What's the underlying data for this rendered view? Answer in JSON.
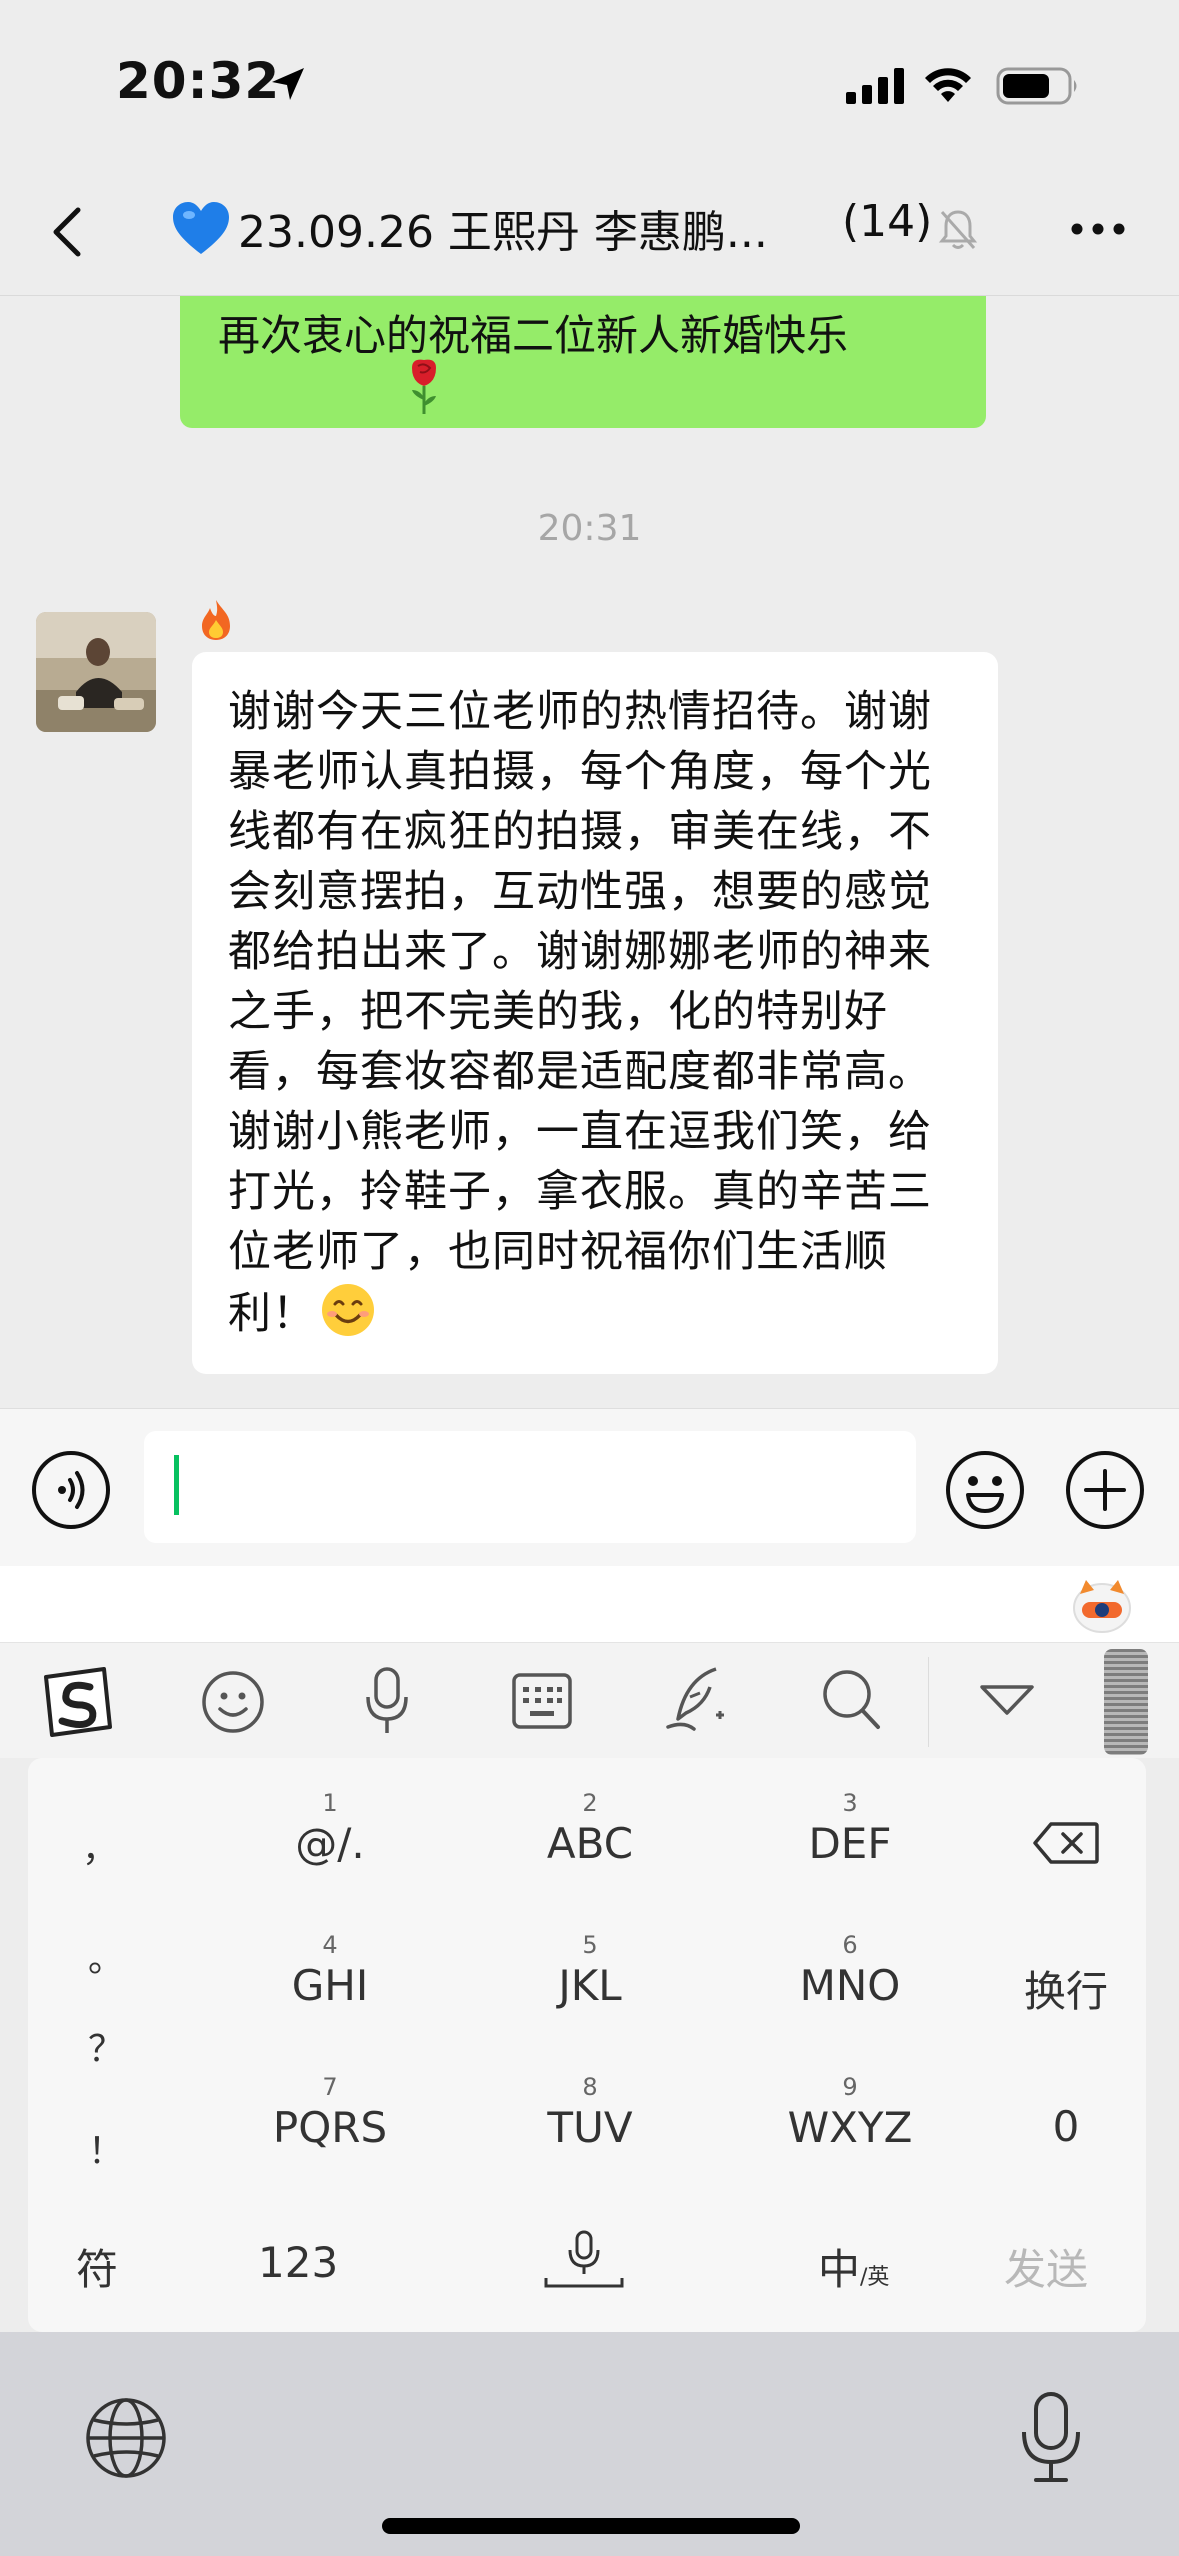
{
  "status_bar": {
    "time": "20:32",
    "icons": [
      "location-arrow-icon",
      "cellular-signal-icon",
      "wifi-icon",
      "battery-icon"
    ]
  },
  "nav": {
    "title": "23.09.26 王熙丹 李惠鹏...",
    "member_count": "(14)",
    "title_emoji": "blue-heart-icon",
    "icons": [
      "back-icon",
      "mute-bell-icon",
      "more-icon"
    ]
  },
  "messages": {
    "previous": {
      "text": "再次衷心的祝福二位新人新婚快乐",
      "emoji": "rose-icon",
      "bubble_color": "#95ec69"
    },
    "time_divider": "20:31",
    "incoming": {
      "sender_emoji": "fire-icon",
      "text": "谢谢今天三位老师的热情招待。谢谢暴老师认真拍摄，每个角度，每个光线都有在疯狂的拍摄，审美在线，不会刻意摆拍，互动性强，想要的感觉都给拍出来了。谢谢娜娜老师的神来之手，把不完美的我，化的特别好看，每套妆容都是适配度都非常高。谢谢小熊老师，一直在逗我们笑，给打光，拎鞋子，拿衣服。真的辛苦三位老师了，也同时祝福你们生活顺利！",
      "emoji": "smiling-face-icon"
    }
  },
  "input_bar": {
    "value": "",
    "cursor_color": "#07c160",
    "icons": [
      "voice-icon",
      "emoji-icon",
      "plus-icon"
    ]
  },
  "keyboard": {
    "toolbar_icons": [
      "sogou-logo-icon",
      "emoji-icon",
      "microphone-icon",
      "keyboard-icon",
      "handwriting-icon",
      "search-icon",
      "collapse-icon"
    ],
    "punctuation": [
      "，",
      "。",
      "？",
      "！"
    ],
    "keys": [
      {
        "num": "1",
        "letters": "@/."
      },
      {
        "num": "2",
        "letters": "ABC"
      },
      {
        "num": "3",
        "letters": "DEF"
      },
      {
        "num": "4",
        "letters": "GHI"
      },
      {
        "num": "5",
        "letters": "JKL"
      },
      {
        "num": "6",
        "letters": "MNO"
      },
      {
        "num": "7",
        "letters": "PQRS"
      },
      {
        "num": "8",
        "letters": "TUV"
      },
      {
        "num": "9",
        "letters": "WXYZ"
      }
    ],
    "newline": "换行",
    "zero": "0",
    "symbols": "符",
    "numbers": "123",
    "lang_main": "中",
    "lang_sub": "/英",
    "send": "发送",
    "bottom_icons": [
      "globe-icon",
      "dictation-microphone-icon"
    ]
  }
}
